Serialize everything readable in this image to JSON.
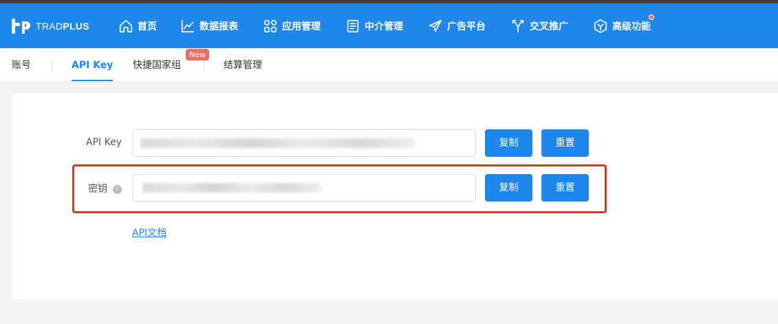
{
  "brand": {
    "logo_text_light": "TRAD",
    "logo_text_bold": "PLUS"
  },
  "nav": {
    "items": [
      {
        "label": "首页",
        "icon": "home-icon"
      },
      {
        "label": "数据报表",
        "icon": "chart-line-icon"
      },
      {
        "label": "应用管理",
        "icon": "grid-apps-icon"
      },
      {
        "label": "中介管理",
        "icon": "document-list-icon"
      },
      {
        "label": "广告平台",
        "icon": "paper-plane-icon"
      },
      {
        "label": "交叉推广",
        "icon": "cross-arrows-icon"
      },
      {
        "label": "高级功能",
        "icon": "hexagon-icon"
      }
    ],
    "accent": "#1f86ea"
  },
  "tabs": [
    {
      "label": "账号"
    },
    {
      "label": "API Key",
      "active": true
    },
    {
      "label": "快捷国家组",
      "badge": "New"
    },
    {
      "label": "结算管理"
    }
  ],
  "form": {
    "api_key": {
      "label": "API Key",
      "copy_label": "复制",
      "reset_label": "重置"
    },
    "secret": {
      "label": "密钥",
      "info": "i",
      "copy_label": "复制",
      "reset_label": "重置"
    },
    "doc_link": "API文档"
  },
  "colors": {
    "primary": "#1f86ea",
    "highlight": "#f22a22",
    "badge": "#f56c6c"
  }
}
